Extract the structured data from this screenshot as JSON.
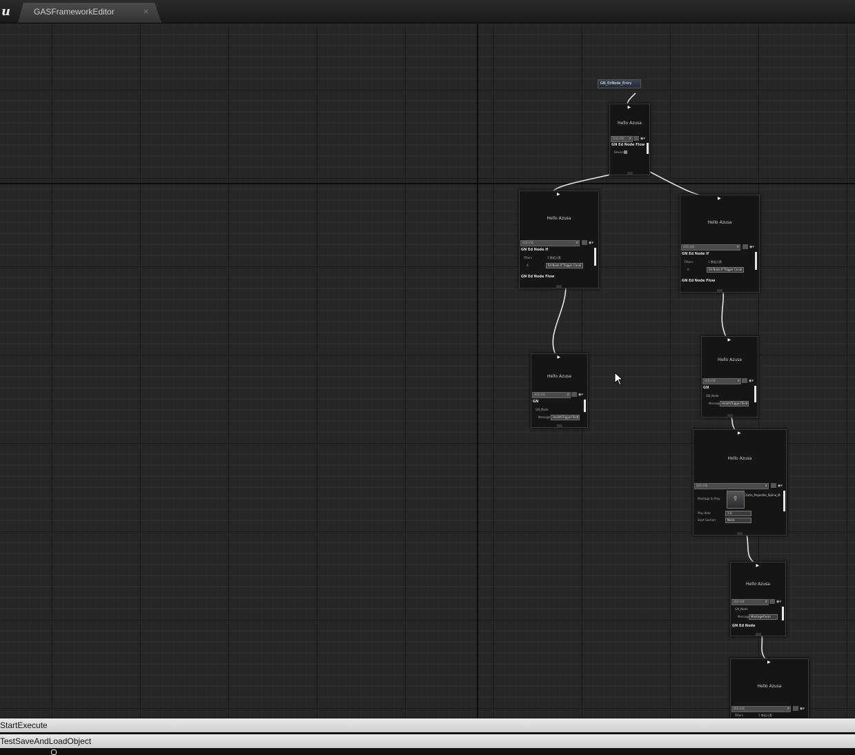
{
  "window": {
    "logo": "u",
    "tab_title": "GASFrameworkEditor",
    "tab_close": "×"
  },
  "graph": {
    "entry_node": {
      "title": "GN_EdNode_Entry"
    },
    "nodes": [
      {
        "title": "Hello Azusa",
        "search_placeholder": "搜索详情",
        "category": "GN Ed Node Flow",
        "row_label": "Device"
      },
      {
        "title": "Hello Azusa",
        "search_placeholder": "搜索详情",
        "category": "GN Ed Node If",
        "filters_label": "Filters",
        "filters_count": "1 数组元素",
        "index": "0",
        "chip": "Ed Node If Trigger Condi",
        "category2": "GN Ed Node Flow"
      },
      {
        "title": "Hello Azusa",
        "search_placeholder": "搜索详情",
        "category": "GN Ed Node If",
        "filters_label": "Filters",
        "filters_count": "1 数组元素",
        "index": "0",
        "chip": "Ed Node If Trigger Condi",
        "category2": "GN Ed Node Flow"
      },
      {
        "title": "Hello Azusa",
        "search_placeholder": "搜索详情",
        "category": "GN",
        "sub": "GN_Node",
        "message_label": "Message",
        "message": "HealthTrigger/TestHP"
      },
      {
        "title": "Hello Azusa",
        "search_placeholder": "搜索详情",
        "category": "GN",
        "sub": "GN_Node",
        "message_label": "Message",
        "message": "HealthTrigger/TestHP"
      },
      {
        "title": "Hello Azusa",
        "search_placeholder": "搜索详情",
        "montage_label": "Montage to Play",
        "montage_asset": "Zutin_Projectile_Spline_M",
        "play_rate_label": "Play Rate",
        "play_rate": "1.0",
        "start_section_label": "Start Section",
        "start_section": "None"
      },
      {
        "title": "Hello Azusa",
        "search_placeholder": "搜索详情",
        "sub": "GN_Node",
        "message_label": "Message",
        "message": "MontageFinish",
        "category2": "GN Ed Node"
      },
      {
        "title": "Hello Azusa",
        "search_placeholder": "搜索详情",
        "filters_label": "Filters",
        "filters_count": "1 数组元素"
      }
    ]
  },
  "bottom_panel": {
    "rows": [
      "StartExecute",
      "TestSaveAndLoadObject"
    ]
  },
  "icons": [
    "unreal-logo-icon",
    "close-icon",
    "search-icon",
    "execution-pin-icon",
    "mouse-cursor-icon"
  ]
}
